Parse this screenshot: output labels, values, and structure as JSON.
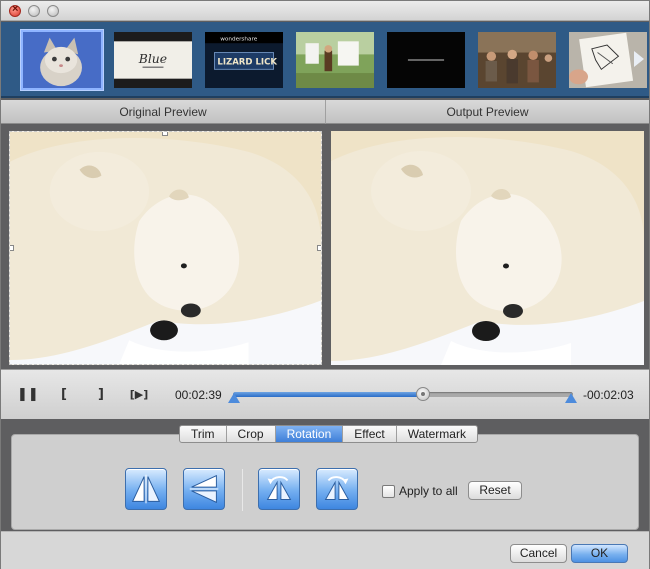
{
  "window": {
    "traffic_lights": [
      "close",
      "minimize",
      "zoom"
    ]
  },
  "thumbnails": {
    "items": [
      {
        "label": "kitten",
        "selected": true
      },
      {
        "label": "blue",
        "text": "Blue"
      },
      {
        "label": "wondershare",
        "text_top": "wondershare",
        "text_main": "LIZARD LICK"
      },
      {
        "label": "laundry-yard"
      },
      {
        "label": "black-title"
      },
      {
        "label": "group-scene"
      },
      {
        "label": "hand-drawing"
      }
    ],
    "next_icon": "chevron-right-icon"
  },
  "preview": {
    "original_label": "Original Preview",
    "output_label": "Output Preview"
  },
  "playback": {
    "pause_icon": "pause-icon",
    "mark_in_icon": "[",
    "mark_out_icon": "]",
    "next_frame_icon": "[▶]",
    "current_time": "00:02:39",
    "remaining_time": "-00:02:03",
    "progress": 0.56
  },
  "tabs": [
    {
      "label": "Trim",
      "active": false
    },
    {
      "label": "Crop",
      "active": false
    },
    {
      "label": "Rotation",
      "active": true
    },
    {
      "label": "Effect",
      "active": false
    },
    {
      "label": "Watermark",
      "active": false
    }
  ],
  "rotation": {
    "buttons": [
      {
        "icon": "flip-horizontal-icon"
      },
      {
        "icon": "flip-vertical-icon"
      },
      {
        "icon": "rotate-left-icon"
      },
      {
        "icon": "rotate-right-icon"
      }
    ],
    "apply_to_all_label": "Apply to all",
    "apply_to_all_checked": false,
    "reset_label": "Reset"
  },
  "footer": {
    "cancel_label": "Cancel",
    "ok_label": "OK"
  },
  "colors": {
    "accent": "#3f7fd8",
    "strip_bg": "#2f5a86"
  }
}
